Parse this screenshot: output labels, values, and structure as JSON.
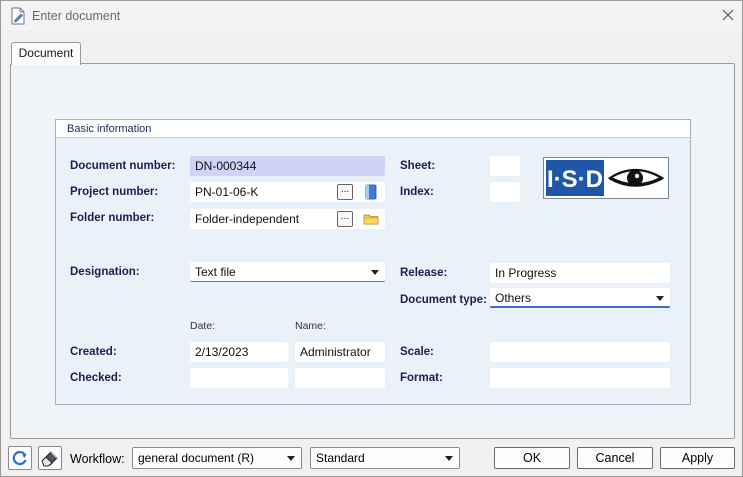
{
  "window": {
    "title": "Enter document",
    "icon": "document-edit-icon",
    "close_icon": "close-icon"
  },
  "tabs": [
    {
      "label": "Document"
    }
  ],
  "basic_info": {
    "title": "Basic information",
    "document_number": {
      "label": "Document number:",
      "value": "DN-000344"
    },
    "project_number": {
      "label": "Project number:",
      "value": "PN-01-06-K",
      "browse": "..."
    },
    "folder_number": {
      "label": "Folder number:",
      "value": "Folder-independent",
      "browse": "..."
    },
    "sheet": {
      "label": "Sheet:",
      "value": ""
    },
    "index": {
      "label": "Index:",
      "value": ""
    },
    "logo": {
      "text": "I·S·D"
    },
    "designation": {
      "label": "Designation:",
      "value": "Text file"
    },
    "release": {
      "label": "Release:",
      "value": "In Progress"
    },
    "document_type": {
      "label": "Document type:",
      "value": "Others"
    },
    "date_header": "Date:",
    "name_header": "Name:",
    "created": {
      "label": "Created:",
      "date": "2/13/2023",
      "name": "Administrator"
    },
    "checked": {
      "label": "Checked:",
      "date": "",
      "name": ""
    },
    "scale": {
      "label": "Scale:",
      "value": ""
    },
    "format": {
      "label": "Format:",
      "value": ""
    }
  },
  "footer": {
    "workflow_label": "Workflow:",
    "workflow_value": "general document (R)",
    "standard_value": "Standard",
    "ok": "OK",
    "cancel": "Cancel",
    "apply": "Apply"
  },
  "colors": {
    "highlight_field": "#cdd4f6",
    "panel_bg": "#eff4f9",
    "label_text": "#1a2050",
    "logo_blue": "#1f57a8"
  }
}
